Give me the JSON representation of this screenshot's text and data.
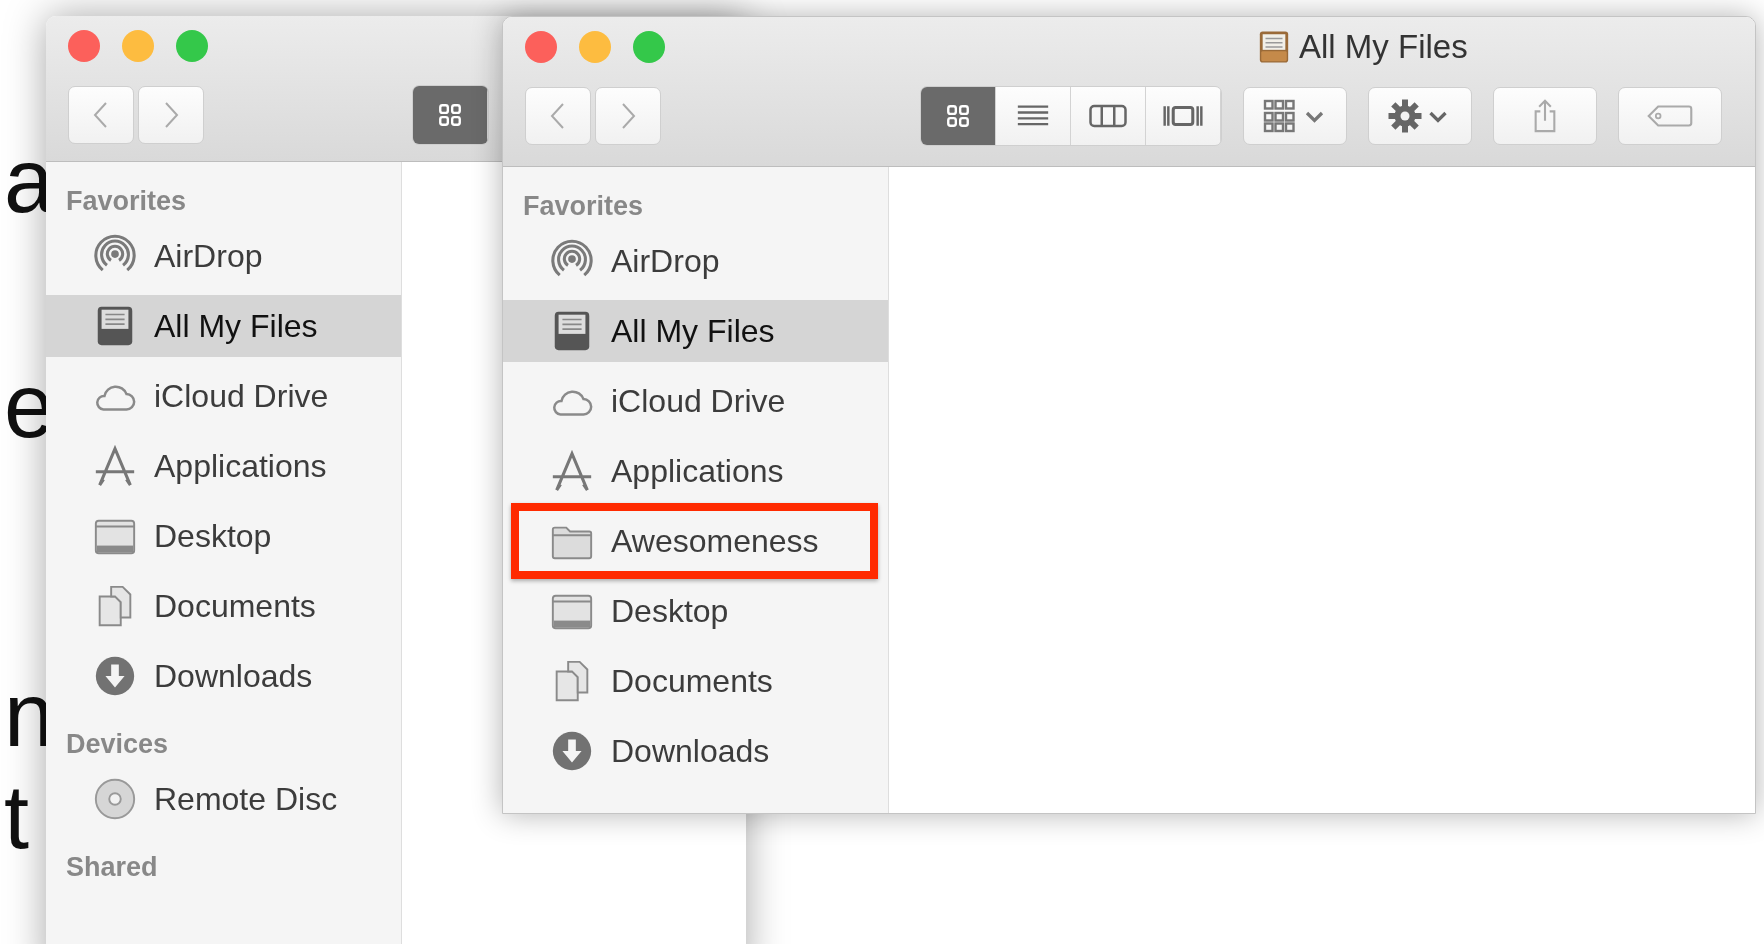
{
  "background_text": [
    "a",
    "e",
    "n",
    "t"
  ],
  "back_window": {
    "view_buttons": [
      {
        "kind": "icons",
        "selected": true
      }
    ],
    "sidebar": [
      {
        "heading": "Favorites",
        "items": [
          {
            "label": "AirDrop",
            "kind": "airdrop",
            "selected": false
          },
          {
            "label": "All My Files",
            "kind": "files",
            "selected": true
          },
          {
            "label": "iCloud Drive",
            "kind": "cloud",
            "selected": false
          },
          {
            "label": "Applications",
            "kind": "apps",
            "selected": false
          },
          {
            "label": "Desktop",
            "kind": "desktop",
            "selected": false
          },
          {
            "label": "Documents",
            "kind": "documents",
            "selected": false
          },
          {
            "label": "Downloads",
            "kind": "downloads",
            "selected": false
          }
        ]
      },
      {
        "heading": "Devices",
        "items": [
          {
            "label": "Remote Disc",
            "kind": "disc",
            "selected": false
          }
        ]
      },
      {
        "heading": "Shared"
      }
    ]
  },
  "front_window": {
    "title": "All My Files",
    "view_buttons": [
      {
        "kind": "icons",
        "selected": true
      },
      {
        "kind": "list",
        "selected": false
      },
      {
        "kind": "columns",
        "selected": false
      },
      {
        "kind": "coverflow",
        "selected": false
      }
    ],
    "sidebar": [
      {
        "heading": "Favorites",
        "items": [
          {
            "label": "AirDrop",
            "kind": "airdrop",
            "selected": false,
            "highlighted": false
          },
          {
            "label": "All My Files",
            "kind": "files",
            "selected": true,
            "highlighted": false
          },
          {
            "label": "iCloud Drive",
            "kind": "cloud",
            "selected": false,
            "highlighted": false
          },
          {
            "label": "Applications",
            "kind": "apps",
            "selected": false,
            "highlighted": false
          },
          {
            "label": "Awesomeness",
            "kind": "folder",
            "selected": false,
            "highlighted": true
          },
          {
            "label": "Desktop",
            "kind": "desktop",
            "selected": false,
            "highlighted": false
          },
          {
            "label": "Documents",
            "kind": "documents",
            "selected": false,
            "highlighted": false
          },
          {
            "label": "Downloads",
            "kind": "downloads",
            "selected": false,
            "highlighted": false
          }
        ]
      }
    ]
  }
}
